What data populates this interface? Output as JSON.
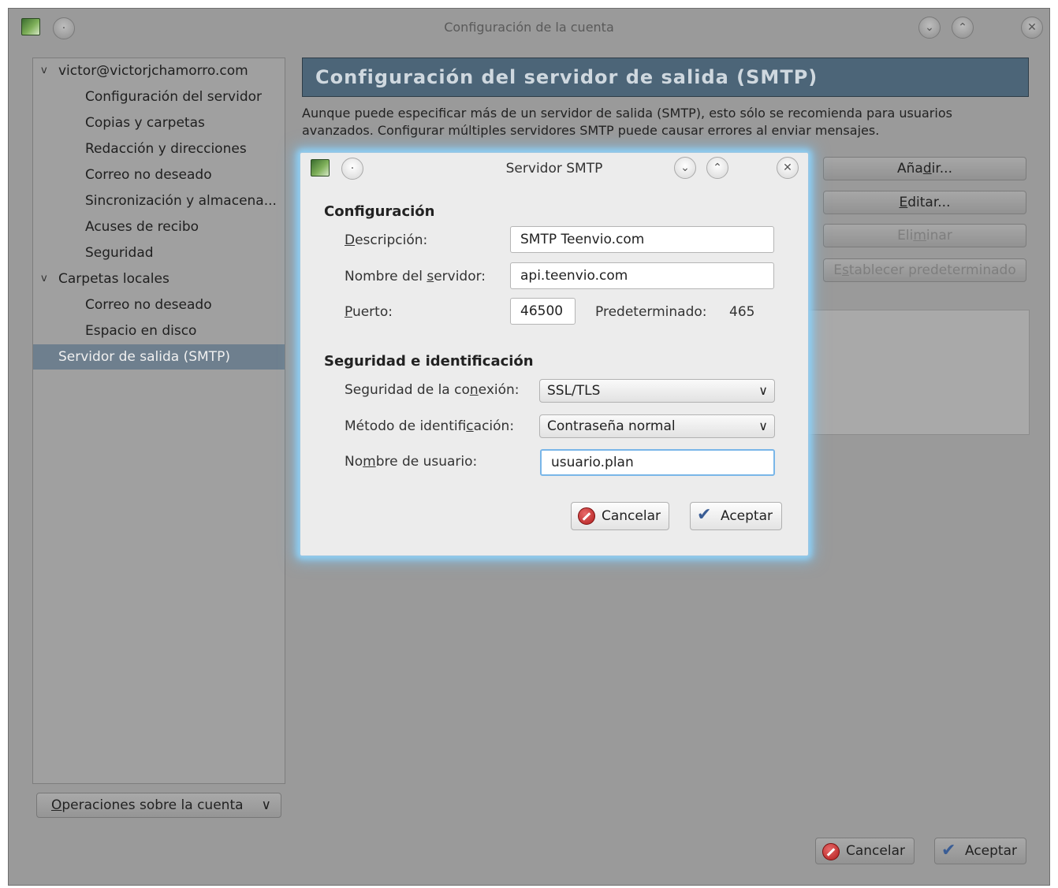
{
  "main_window": {
    "title": "Configuración de la cuenta",
    "icons": {
      "app": "thunderbird-icon",
      "menu": "window-menu-icon",
      "minimize": "chevron-down-icon",
      "maximize": "chevron-up-icon",
      "close": "close-icon"
    }
  },
  "sidebar": {
    "items": [
      {
        "label": "victor@victorjchamorro.com",
        "level": 1,
        "expanded": true
      },
      {
        "label": "Configuración del servidor",
        "level": 2
      },
      {
        "label": "Copias y carpetas",
        "level": 2
      },
      {
        "label": "Redacción y direcciones",
        "level": 2
      },
      {
        "label": "Correo no deseado",
        "level": 2
      },
      {
        "label": "Sincronización y almacena...",
        "level": 2
      },
      {
        "label": "Acuses de recibo",
        "level": 2
      },
      {
        "label": "Seguridad",
        "level": 2
      },
      {
        "label": "Carpetas locales",
        "level": 1,
        "expanded": true
      },
      {
        "label": "Correo no deseado",
        "level": 2
      },
      {
        "label": "Espacio en disco",
        "level": 2
      },
      {
        "label": "Servidor de salida (SMTP)",
        "level": 1,
        "selected": true
      }
    ],
    "account_ops": {
      "mnemonic": "O",
      "rest": "peraciones sobre la cuenta"
    }
  },
  "content": {
    "header": "Configuración del servidor de salida (SMTP)",
    "description": "Aunque puede especificar más de un servidor de salida (SMTP), esto sólo se recomienda para usuarios avanzados. Configurar múltiples servidores SMTP puede causar errores al enviar mensajes.",
    "buttons": {
      "add": {
        "pre": "Aña",
        "mn": "d",
        "post": "ir..."
      },
      "edit": {
        "pre": "",
        "mn": "E",
        "post": "ditar..."
      },
      "delete": {
        "pre": "Eli",
        "mn": "m",
        "post": "inar"
      },
      "set_default": {
        "pre": "E",
        "mn": "s",
        "post": "tablecer predeterminado"
      }
    }
  },
  "footer": {
    "cancel": "Cancelar",
    "accept": "Aceptar"
  },
  "dialog": {
    "title": "Servidor SMTP",
    "settings_group": "Configuración",
    "description_label": {
      "pre": "",
      "mn": "D",
      "post": "escripción:"
    },
    "description_value": "SMTP Teenvio.com",
    "server_label": {
      "pre": "Nombre del ",
      "mn": "s",
      "post": "ervidor:"
    },
    "server_value": "api.teenvio.com",
    "port_label": {
      "pre": "",
      "mn": "P",
      "post": "uerto:"
    },
    "port_value": "46500",
    "default_label": "Predeterminado:",
    "default_value": "465",
    "security_group": "Seguridad e identificación",
    "conn_security_label": {
      "pre": "Seguridad de la co",
      "mn": "n",
      "post": "exión:"
    },
    "conn_security_value": "SSL/TLS",
    "auth_method_label": {
      "pre": "Método de identifi",
      "mn": "c",
      "post": "ación:"
    },
    "auth_method_value": "Contraseña normal",
    "username_label": {
      "pre": "No",
      "mn": "m",
      "post": "bre de usuario:"
    },
    "username_value": "usuario.plan",
    "cancel": "Cancelar",
    "accept": "Aceptar"
  },
  "colors": {
    "header_bg": "#4c6578",
    "selected_bg": "#6e7f8e",
    "focus": "#79b6e8",
    "glow": "#8fd0f5"
  }
}
